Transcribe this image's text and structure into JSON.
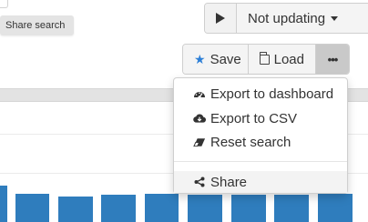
{
  "tooltip": {
    "text": "Share search"
  },
  "update_control": {
    "play_icon": "play-icon",
    "status_label": "Not updating"
  },
  "actions": {
    "save_label": "Save",
    "load_label": "Load",
    "more_icon": "more-dots-icon"
  },
  "menu": {
    "items": [
      {
        "label": "Export to dashboard",
        "icon": "dashboard-icon"
      },
      {
        "label": "Export to CSV",
        "icon": "cloud-download-icon"
      },
      {
        "label": "Reset search",
        "icon": "eraser-icon"
      }
    ],
    "share_label": "Share",
    "share_icon": "share-icon"
  },
  "colors": {
    "accent": "#2d7fd7",
    "bar": "#2f7dbd",
    "band": "#e3e3e3"
  }
}
